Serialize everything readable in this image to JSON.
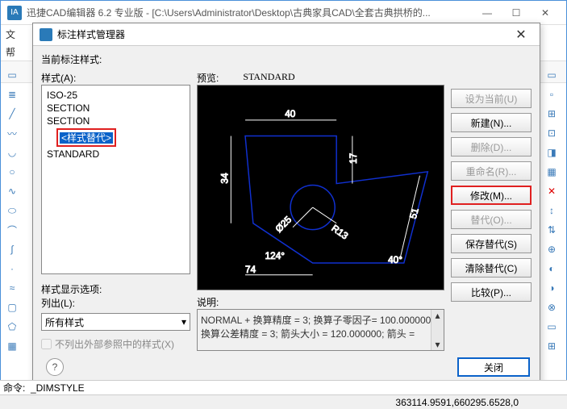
{
  "window": {
    "title": "迅捷CAD编辑器 6.2 专业版  -  [C:\\Users\\Administrator\\Desktop\\古典家具CAD\\全套古典拱桥的...",
    "appicon": "IA"
  },
  "menubar": {
    "file": "文",
    "help": "帮"
  },
  "dialog": {
    "title": "标注样式管理器",
    "current_label": "当前标注样式:",
    "styles_label": "样式(A):",
    "preview_label": "预览:",
    "preview_name": "STANDARD",
    "tree": {
      "i0": "ISO-25",
      "i1": "SECTION",
      "i2": "SECTION",
      "i3": "<样式替代>",
      "i4": "STANDARD"
    },
    "dispopt_label": "样式显示选项:",
    "list_label": "列出(L):",
    "list_value": "所有样式",
    "ext_chk": "不列出外部参照中的样式(X)",
    "desc_label": "说明:",
    "desc_text": "NORMAL + 换算精度 = 3; 换算子零因子= 100.000000; 换算公差精度 = 3; 箭头大小 = 120.000000; 箭头 =",
    "buttons": {
      "set_current": "设为当前(U)",
      "new": "新建(N)...",
      "delete": "删除(D)...",
      "rename": "重命名(R)...",
      "modify": "修改(M)...",
      "override": "替代(O)...",
      "save_override": "保存替代(S)",
      "clear_override": "清除替代(C)",
      "compare": "比较(P)...",
      "close": "关闭"
    }
  },
  "cmd": {
    "label": "命令:",
    "value": "_DIMSTYLE"
  },
  "status": {
    "coords": "363114.9591,660295.6528,0"
  },
  "chart_data": {
    "type": "diagram",
    "note": "CAD dimension style preview drawing",
    "dims": {
      "top": "40",
      "right": "17",
      "left": "34",
      "diameter": "Ø25",
      "radius": "R13",
      "angle1": "124°",
      "angle2": "40°",
      "bottom": "74",
      "diag": "51"
    }
  }
}
